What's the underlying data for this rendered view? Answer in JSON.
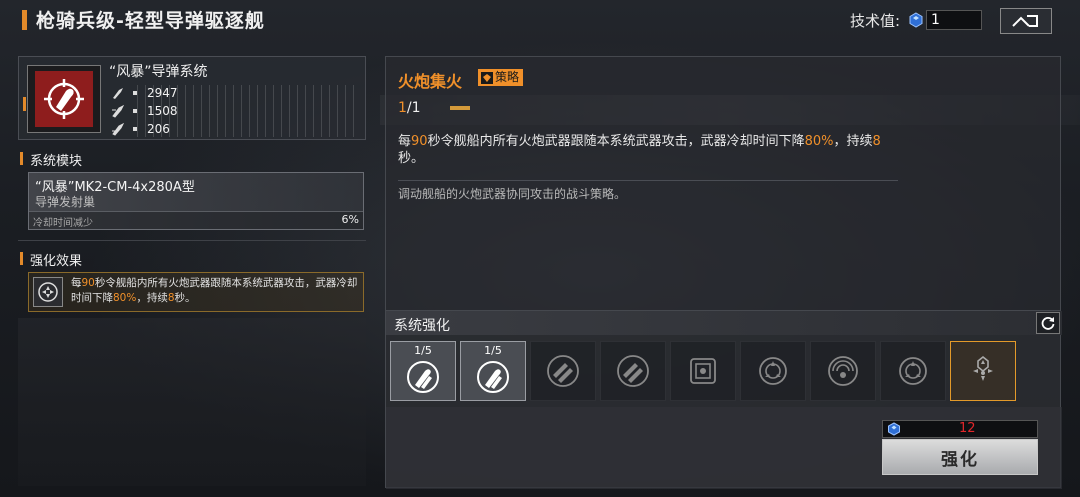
{
  "header": {
    "title": "枪骑兵级-轻型导弹驱逐舰",
    "tech_label": "技术值:",
    "tech_value": "1"
  },
  "weapon": {
    "name": "“风暴”导弹系统",
    "stats": [
      "2947",
      "1508",
      "206"
    ]
  },
  "module": {
    "section_title": "系统模块",
    "name": "“风暴”MK2-CM-4x280A型",
    "type": "导弹发射巢",
    "attr_label": "冷却时间减少",
    "attr_value": "6%"
  },
  "enhance": {
    "section_title": "强化效果",
    "text_parts": [
      "每",
      "90",
      "秒令舰船内所有火炮武器跟随本系统武器攻击，武器冷却时间下降",
      "80%",
      "，持续",
      "8",
      "秒。"
    ]
  },
  "detail": {
    "title": "火炮集火",
    "tag": "策略",
    "level_current": "1",
    "level_sep": "/",
    "level_max": "1",
    "desc_parts": [
      "每",
      "90",
      "秒令舰船内所有火炮武器跟随本系统武器攻击，武器冷却时间下降",
      "80%",
      "，持续",
      "8",
      "秒。"
    ],
    "flavor": "调动舰船的火炮武器协同攻击的战斗策略。"
  },
  "upgrade": {
    "title": "系统强化",
    "slots": [
      {
        "level": "1/5",
        "icon": "missile-target-icon",
        "state": "active"
      },
      {
        "level": "1/5",
        "icon": "missile-target-icon",
        "state": "active"
      },
      {
        "level": "",
        "icon": "missile-pair-icon",
        "state": "locked"
      },
      {
        "level": "",
        "icon": "missile-pair-icon",
        "state": "locked"
      },
      {
        "level": "",
        "icon": "chip-icon",
        "state": "locked"
      },
      {
        "level": "",
        "icon": "crosshair-icon",
        "state": "locked"
      },
      {
        "level": "",
        "icon": "radar-icon",
        "state": "locked"
      },
      {
        "level": "",
        "icon": "crosshair-icon",
        "state": "locked"
      },
      {
        "level": "",
        "icon": "focus-fire-icon",
        "state": "selected"
      }
    ],
    "cost": "12",
    "button": "强化"
  },
  "colors": {
    "accent": "#f0902a",
    "cost_red": "#e0262a",
    "weapon_bg": "#8e1d1d"
  }
}
